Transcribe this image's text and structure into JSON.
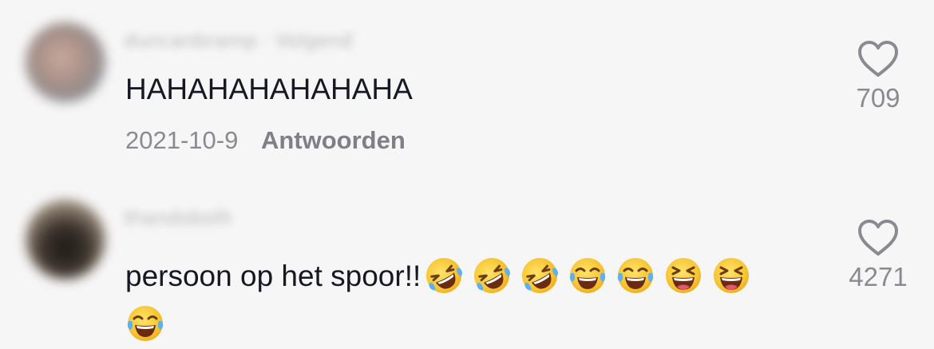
{
  "comments": [
    {
      "username": "duncanbramp · Volgend",
      "text": "HAHAHAHAHAHAHA",
      "date": "2021-10-9",
      "reply_label": "Antwoorden",
      "like_count": "709",
      "emojis": []
    },
    {
      "username": "thandobolh",
      "text": "persoon op het spoor!!",
      "like_count": "4271",
      "emojis": [
        "rofl-emoji",
        "rofl-emoji",
        "rofl-emoji",
        "tears-of-joy-emoji",
        "tears-of-joy-emoji",
        "squinting-laugh-emoji",
        "squinting-laugh-emoji",
        "tears-of-joy-emoji"
      ]
    }
  ],
  "colors": {
    "background": "#f7f6f6",
    "text": "#161823",
    "meta": "#8a8b91",
    "emoji_face": "#f7c532"
  }
}
